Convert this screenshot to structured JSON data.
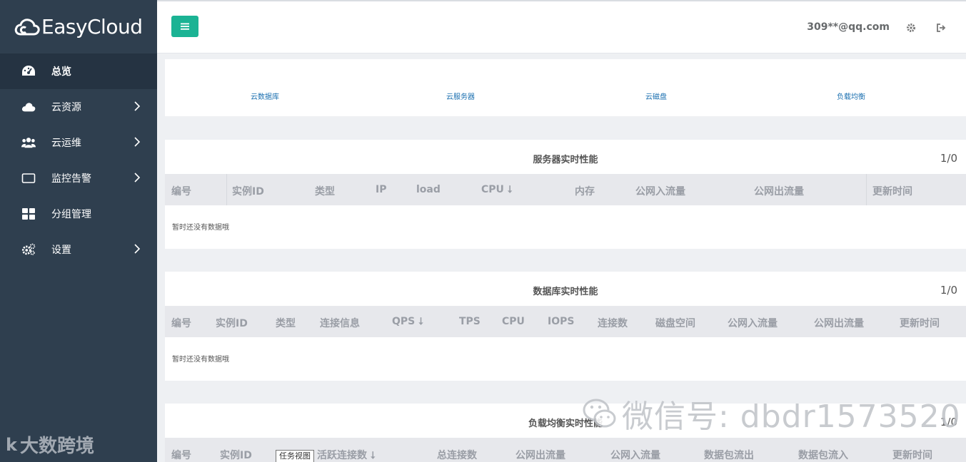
{
  "app": {
    "name": "EasyCloud"
  },
  "sidebar": {
    "items": [
      {
        "label": "总览",
        "icon": "dashboard-icon",
        "active": true,
        "has_children": false
      },
      {
        "label": "云资源",
        "icon": "cloud-icon",
        "active": false,
        "has_children": true
      },
      {
        "label": "云运维",
        "icon": "users-icon",
        "active": false,
        "has_children": true
      },
      {
        "label": "监控告警",
        "icon": "monitor-icon",
        "active": false,
        "has_children": true
      },
      {
        "label": "分组管理",
        "icon": "grid-icon",
        "active": false,
        "has_children": false
      },
      {
        "label": "设置",
        "icon": "gears-icon",
        "active": false,
        "has_children": true
      }
    ]
  },
  "header": {
    "user_email": "309**@qq.com"
  },
  "quick_links": [
    "云数据库",
    "云服务器",
    "云磁盘",
    "负载均衡"
  ],
  "panels": [
    {
      "title": "服务器实时性能",
      "page": "1/0",
      "columns": [
        "编号",
        "实例ID",
        "类型",
        "IP",
        "load",
        "CPU ⭣",
        "内存",
        "公网入流量",
        "公网出流量",
        "更新时间"
      ],
      "empty_text": "暂时还没有数据哦"
    },
    {
      "title": "数据库实时性能",
      "page": "1/0",
      "columns": [
        "编号",
        "实例ID",
        "类型",
        "连接信息",
        "QPS ⭣",
        "TPS",
        "CPU",
        "IOPS",
        "连接数",
        "磁盘空间",
        "公网入流量",
        "公网出流量",
        "更新时间"
      ],
      "empty_text": "暂时还没有数据哦"
    },
    {
      "title": "负载均衡实时性能",
      "page": "1/0",
      "columns": [
        "编号",
        "实例ID",
        "",
        "活跃连接数 ⭣",
        "总连接数",
        "公网出流量",
        "公网入流量",
        "数据包流出",
        "数据包流入",
        "更新时间"
      ],
      "empty_text": ""
    }
  ],
  "overlays": {
    "taskview_label": "任务视图",
    "wechat_watermark": "微信号: dbdr1573520",
    "brand_watermark": "大数跨境",
    "brand_watermark_logo": "k"
  },
  "colors": {
    "sidebar_bg": "#2f3f4f",
    "accent": "#1bb394",
    "link": "#1a6fb0"
  }
}
